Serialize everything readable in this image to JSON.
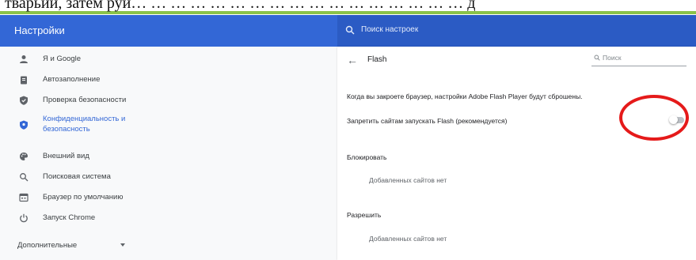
{
  "caption": "тварьий, затем руй…  …  …  …  …  …  …  …  …  …  …  …  …  …  …  …  …  д",
  "header": {
    "title": "Настройки",
    "search_placeholder": "Поиск настроек"
  },
  "sidebar": {
    "items": [
      {
        "label": "Я и Google",
        "icon": "person-icon"
      },
      {
        "label": "Автозаполнение",
        "icon": "clipboard-icon"
      },
      {
        "label": "Проверка безопасности",
        "icon": "shield-check-icon"
      },
      {
        "label": "Конфиденциальность и безопасность",
        "label_line1": "Конфиденциальность и",
        "label_line2": "безопасность",
        "icon": "shield-lock-icon",
        "active": true
      },
      {
        "label": "Внешний вид",
        "icon": "palette-icon"
      },
      {
        "label": "Поисковая система",
        "icon": "search-icon"
      },
      {
        "label": "Браузер по умолчанию",
        "icon": "browser-icon"
      },
      {
        "label": "Запуск Chrome",
        "icon": "power-icon"
      }
    ],
    "advanced_label": "Дополнительные"
  },
  "content": {
    "page_title": "Flash",
    "search_placeholder": "Поиск",
    "description": "Когда вы закроете браузер, настройки Adobe Flash Player будут сброшены.",
    "toggle_label": "Запретить сайтам запускать Flash (рекомендуется)",
    "toggle_on": false,
    "block_heading": "Блокировать",
    "block_empty": "Добавленных сайтов нет",
    "allow_heading": "Разрешить",
    "allow_empty": "Добавленных сайтов нет"
  },
  "colors": {
    "header": "#3367d6",
    "active": "#3367d6",
    "annotation": "#e51a1a"
  }
}
